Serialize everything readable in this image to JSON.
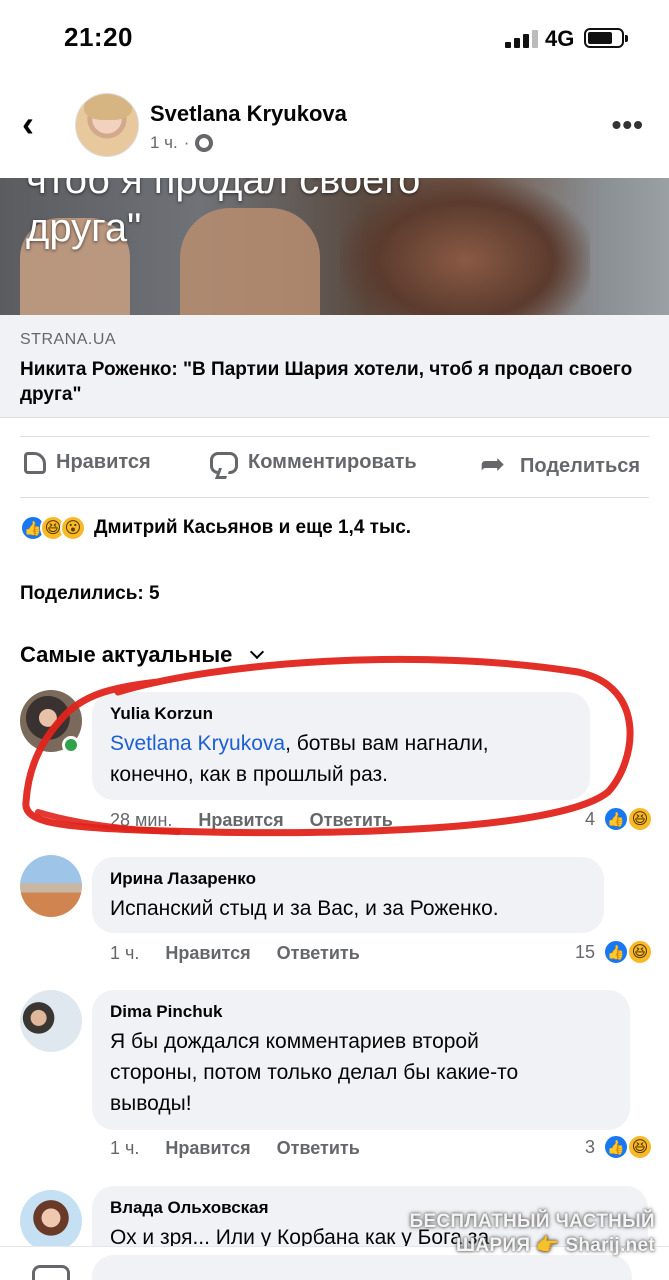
{
  "status_bar": {
    "time": "21:20",
    "network": "4G"
  },
  "post": {
    "author": "Svetlana Kryukova",
    "time": "1 ч.",
    "separator": "·",
    "image_overlay_text": "чтоб я продал своего\nдруга\"",
    "article_source": "STRANA.UA",
    "article_title": "Никита Роженко: \"В Партии Шария хотели, чтоб я продал своего друга\""
  },
  "actions": {
    "like": "Нравится",
    "comment": "Комментировать",
    "share": "Поделиться"
  },
  "reactions_summary": "Дмитрий Касьянов и еще 1,4 тыс.",
  "shares": "Поделились: 5",
  "sort_label": "Самые актуальные",
  "comments": [
    {
      "author": "Yulia Korzun",
      "mention": "Svetlana Kryukova",
      "text": ", ботвы  вам нагнали,\nконечно, как в прошлый раз.",
      "time": "28 мин.",
      "like_label": "Нравится",
      "reply_label": "Ответить",
      "count": "4"
    },
    {
      "author": "Ирина Лазаренко",
      "text": "Испанский стыд и за Вас, и за Роженко.",
      "time": "1 ч.",
      "like_label": "Нравится",
      "reply_label": "Ответить",
      "count": "15"
    },
    {
      "author": "Dima Pinchuk",
      "text": "Я бы дождался комментариев второй\nстороны, потом только делал бы какие-то\nвыводы!",
      "time": "1 ч.",
      "like_label": "Нравится",
      "reply_label": "Ответить",
      "count": "3"
    },
    {
      "author": "Влада Ольховская",
      "text": "Ох и зря... Или у Корбана как у Бога за"
    }
  ],
  "watermark": {
    "line1": "БЕСПЛАТНЫЙ ЧАСТНЫЙ",
    "line2": "ШАРИЯ 👉 Sharij.net"
  },
  "colors": {
    "like_blue": "#1877f2",
    "haha_yellow": "#f7b928",
    "mention_blue": "#1d5fd6",
    "marker_red": "#e0241b",
    "online_green": "#31a24c"
  }
}
